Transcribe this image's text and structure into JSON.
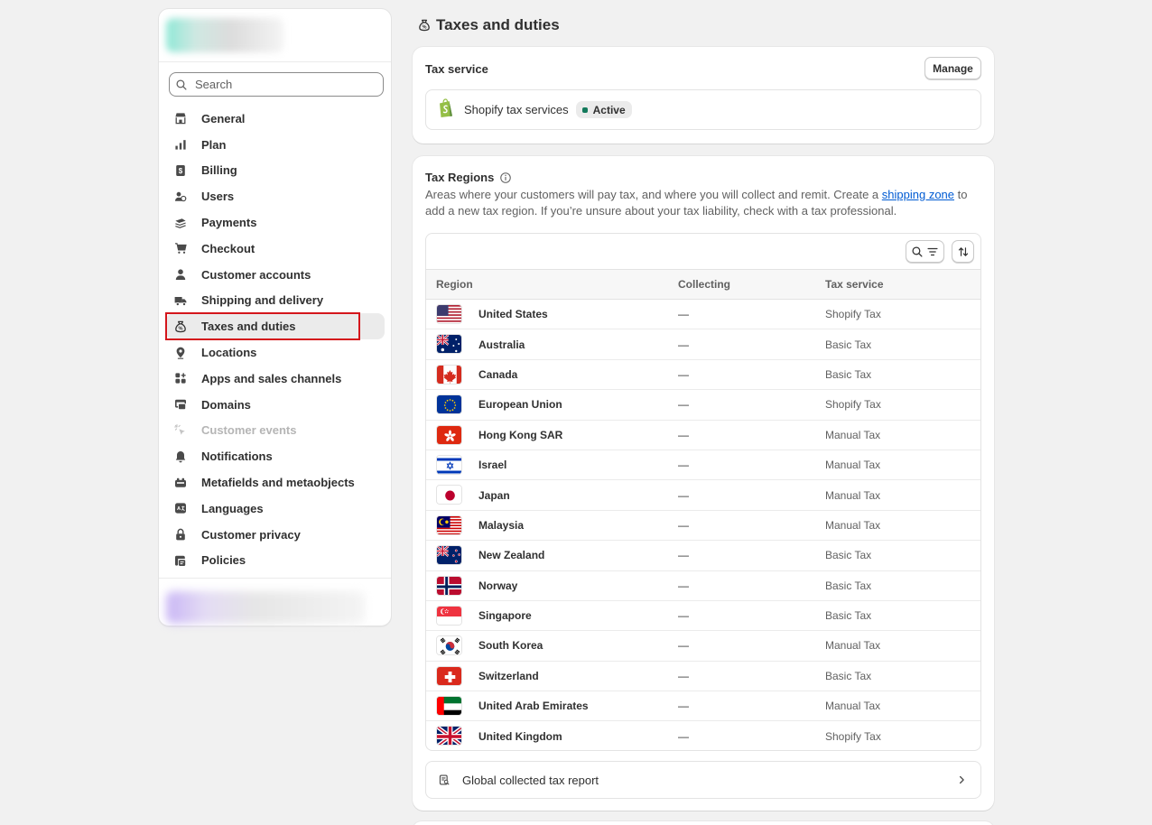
{
  "sidebar": {
    "search_placeholder": "Search",
    "items": [
      {
        "label": "General",
        "icon": "store-icon"
      },
      {
        "label": "Plan",
        "icon": "plan-icon"
      },
      {
        "label": "Billing",
        "icon": "billing-icon"
      },
      {
        "label": "Users",
        "icon": "users-icon"
      },
      {
        "label": "Payments",
        "icon": "payments-icon"
      },
      {
        "label": "Checkout",
        "icon": "cart-icon"
      },
      {
        "label": "Customer accounts",
        "icon": "person-icon"
      },
      {
        "label": "Shipping and delivery",
        "icon": "truck-icon"
      },
      {
        "label": "Taxes and duties",
        "icon": "tax-bag-icon",
        "active": true
      },
      {
        "label": "Locations",
        "icon": "location-icon"
      },
      {
        "label": "Apps and sales channels",
        "icon": "apps-icon"
      },
      {
        "label": "Domains",
        "icon": "domains-icon"
      },
      {
        "label": "Customer events",
        "icon": "cursor-icon",
        "disabled": true
      },
      {
        "label": "Notifications",
        "icon": "bell-icon"
      },
      {
        "label": "Metafields and metaobjects",
        "icon": "metafields-icon"
      },
      {
        "label": "Languages",
        "icon": "language-icon"
      },
      {
        "label": "Customer privacy",
        "icon": "lock-icon"
      },
      {
        "label": "Policies",
        "icon": "policies-icon"
      }
    ]
  },
  "page": {
    "title": "Taxes and duties"
  },
  "tax_service": {
    "title": "Tax service",
    "manage_label": "Manage",
    "service_name": "Shopify tax services",
    "status": "Active",
    "status_color": "#13795b"
  },
  "tax_regions": {
    "title": "Tax Regions",
    "description_before": "Areas where your customers will pay tax, and where you will collect and remit. Create a ",
    "link_text": "shipping zone",
    "description_after": " to add a new tax region. If you’re unsure about your tax liability, check with a tax professional.",
    "columns": [
      "Region",
      "Collecting",
      "Tax service"
    ],
    "rows": [
      {
        "region": "United States",
        "collecting": "—",
        "service": "Shopify Tax",
        "flag": "us"
      },
      {
        "region": "Australia",
        "collecting": "—",
        "service": "Basic Tax",
        "flag": "au"
      },
      {
        "region": "Canada",
        "collecting": "—",
        "service": "Basic Tax",
        "flag": "ca"
      },
      {
        "region": "European Union",
        "collecting": "—",
        "service": "Shopify Tax",
        "flag": "eu"
      },
      {
        "region": "Hong Kong SAR",
        "collecting": "—",
        "service": "Manual Tax",
        "flag": "hk"
      },
      {
        "region": "Israel",
        "collecting": "—",
        "service": "Manual Tax",
        "flag": "il"
      },
      {
        "region": "Japan",
        "collecting": "—",
        "service": "Manual Tax",
        "flag": "jp"
      },
      {
        "region": "Malaysia",
        "collecting": "—",
        "service": "Manual Tax",
        "flag": "my"
      },
      {
        "region": "New Zealand",
        "collecting": "—",
        "service": "Basic Tax",
        "flag": "nz"
      },
      {
        "region": "Norway",
        "collecting": "—",
        "service": "Basic Tax",
        "flag": "no"
      },
      {
        "region": "Singapore",
        "collecting": "—",
        "service": "Basic Tax",
        "flag": "sg"
      },
      {
        "region": "South Korea",
        "collecting": "—",
        "service": "Manual Tax",
        "flag": "kr"
      },
      {
        "region": "Switzerland",
        "collecting": "—",
        "service": "Basic Tax",
        "flag": "ch"
      },
      {
        "region": "United Arab Emirates",
        "collecting": "—",
        "service": "Manual Tax",
        "flag": "ae"
      },
      {
        "region": "United Kingdom",
        "collecting": "—",
        "service": "Shopify Tax",
        "flag": "gb"
      }
    ],
    "report_label": "Global collected tax report"
  }
}
